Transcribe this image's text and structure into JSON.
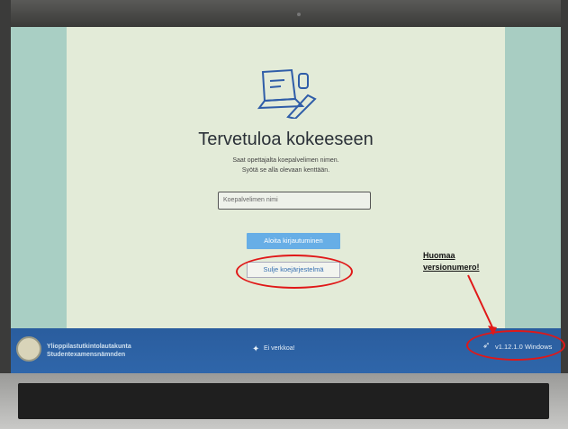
{
  "screen": {
    "title": "Tervetuloa kokeeseen",
    "instruction_line1": "Saat opettajalta koepalvelimen nimen.",
    "instruction_line2": "Syötä se alla olevaan kenttään.",
    "server_input_placeholder": "Koepalvelimen nimi",
    "start_login_button": "Aloita kirjautuminen",
    "close_system_button": "Sulje koejärjestelmä"
  },
  "taskbar": {
    "org_name_fi": "Ylioppilastutkintolautakunta",
    "org_name_sv": "Studentexamensnämnden",
    "network_status": "Ei verkkoa!",
    "version": "v1.12.1.0 Windows"
  },
  "annotation": {
    "note_line1": "Huomaa",
    "note_line2": "versionumero!",
    "color": "#e01818"
  }
}
